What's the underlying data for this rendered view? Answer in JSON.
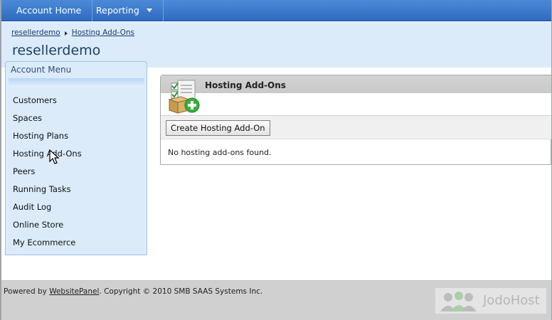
{
  "topnav": {
    "items": [
      {
        "label": "Account Home"
      },
      {
        "label": "Reporting"
      }
    ]
  },
  "breadcrumb": [
    "resellerdemo",
    "Hosting Add-Ons"
  ],
  "page_title": "resellerdemo",
  "account_menu": {
    "title": "Account Menu",
    "items": [
      "Customers",
      "Spaces",
      "Hosting Plans",
      "Hosting Add-Ons",
      "Peers",
      "Running Tasks",
      "Audit Log",
      "Online Store",
      "My Ecommerce"
    ]
  },
  "panel": {
    "title": "Hosting Add-Ons",
    "create_button": "Create Hosting Add-On",
    "empty_message": "No hosting add-ons found."
  },
  "footer": {
    "prefix": "Powered by ",
    "link": "WebsitePanel",
    "suffix": ". Copyright © 2010 SMB SAAS Systems Inc.",
    "logo_text": "JodoHost"
  }
}
